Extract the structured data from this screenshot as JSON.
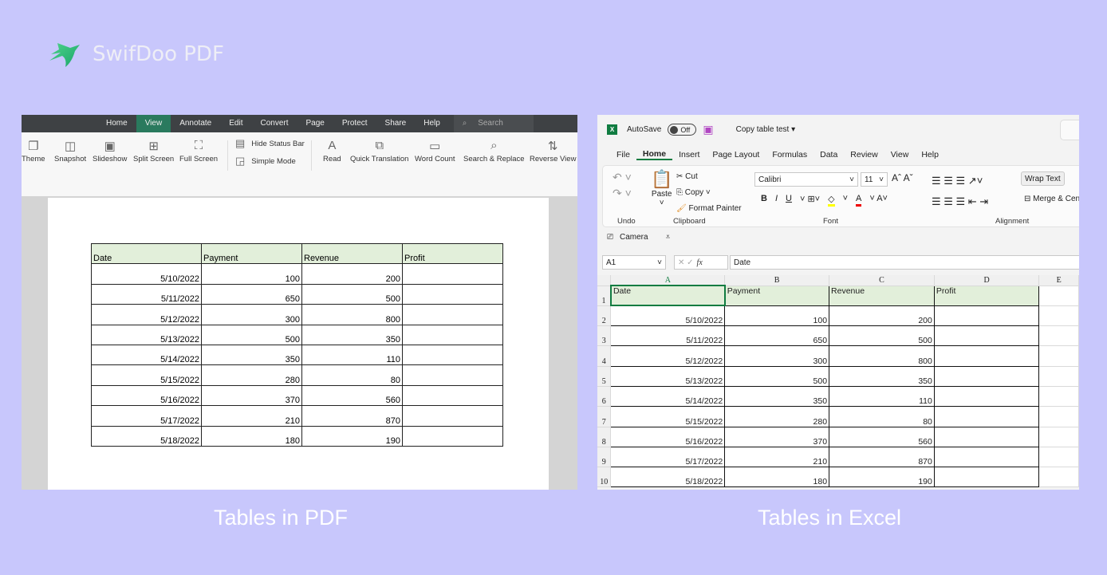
{
  "brand": {
    "name": "SwifDoo PDF",
    "logo_color": "#2ec27e"
  },
  "captions": {
    "pdf": "Tables in PDF",
    "excel": "Tables in Excel"
  },
  "pdf": {
    "menu": [
      "Home",
      "View",
      "Annotate",
      "Edit",
      "Convert",
      "Page",
      "Protect",
      "Share",
      "Help"
    ],
    "active_menu": "View",
    "search_placeholder": "Search Tools",
    "tools": [
      {
        "label": "Theme",
        "icon": "theme-icon",
        "glyph": "❐"
      },
      {
        "label": "Snapshot",
        "icon": "snapshot-icon",
        "glyph": "◫"
      },
      {
        "label": "Slideshow",
        "icon": "slideshow-icon",
        "glyph": "▣"
      },
      {
        "label": "Split Screen",
        "icon": "split-screen-icon",
        "glyph": "⊞"
      },
      {
        "label": "Full Screen",
        "icon": "full-screen-icon",
        "glyph": "⛶"
      }
    ],
    "small_tools": [
      {
        "label": "Hide Status Bar",
        "icon": "hide-status-bar-icon",
        "glyph": "▤"
      },
      {
        "label": "Simple Mode",
        "icon": "simple-mode-icon",
        "glyph": "◲"
      }
    ],
    "tools2": [
      {
        "label": "Read",
        "icon": "read-icon",
        "glyph": "A"
      },
      {
        "label": "Quick Translation",
        "icon": "translation-icon",
        "glyph": "⧉"
      },
      {
        "label": "Word Count",
        "icon": "word-count-icon",
        "glyph": "▭"
      },
      {
        "label": "Search & Replace",
        "icon": "search-replace-icon",
        "glyph": "⌕"
      },
      {
        "label": "Reverse View",
        "icon": "reverse-view-icon",
        "glyph": "⇅"
      }
    ]
  },
  "table": {
    "headers": [
      "Date",
      "Payment",
      "Revenue",
      "Profit"
    ],
    "rows": [
      [
        "5/10/2022",
        "100",
        "200",
        ""
      ],
      [
        "5/11/2022",
        "650",
        "500",
        ""
      ],
      [
        "5/12/2022",
        "300",
        "800",
        ""
      ],
      [
        "5/13/2022",
        "500",
        "350",
        ""
      ],
      [
        "5/14/2022",
        "350",
        "110",
        ""
      ],
      [
        "5/15/2022",
        "280",
        "80",
        ""
      ],
      [
        "5/16/2022",
        "370",
        "560",
        ""
      ],
      [
        "5/17/2022",
        "210",
        "870",
        ""
      ],
      [
        "5/18/2022",
        "180",
        "190",
        ""
      ]
    ],
    "header_bg": "#e2efda"
  },
  "excel": {
    "autosave": "AutoSave",
    "autosave_state": "Off",
    "doc_title": "Copy table test",
    "tabs": [
      "File",
      "Home",
      "Insert",
      "Page Layout",
      "Formulas",
      "Data",
      "Review",
      "View",
      "Help"
    ],
    "active_tab": "Home",
    "clipboard": {
      "paste": "Paste",
      "cut": "Cut",
      "copy": "Copy",
      "format_painter": "Format Painter"
    },
    "font": {
      "name": "Calibri",
      "size": "11"
    },
    "wrap_text": "Wrap Text",
    "merge": "Merge & Cen",
    "groups": [
      "Undo",
      "Clipboard",
      "Font",
      "Alignment"
    ],
    "camera": "Camera",
    "name_box": "A1",
    "formula": "Date",
    "columns": [
      "A",
      "B",
      "C",
      "D",
      "E"
    ],
    "row_numbers": [
      "1",
      "2",
      "3",
      "4",
      "5",
      "6",
      "7",
      "8",
      "9",
      "10"
    ]
  }
}
